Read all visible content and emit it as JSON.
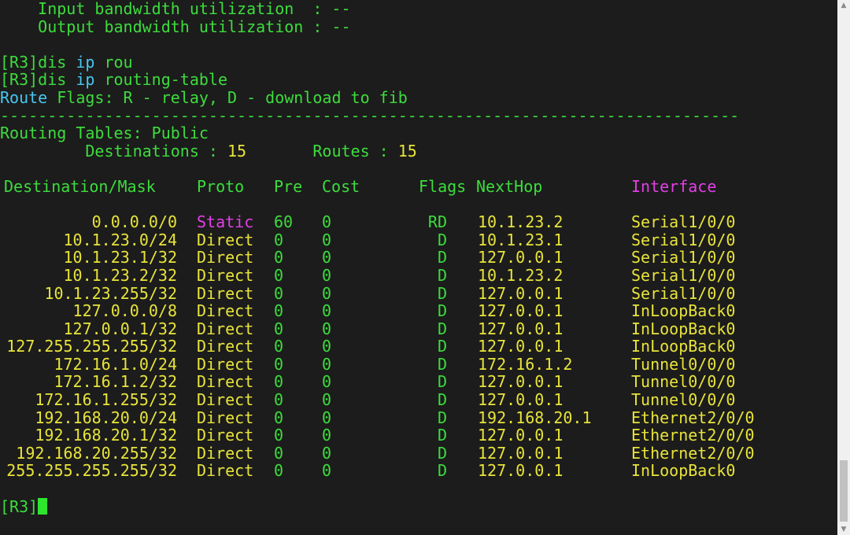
{
  "stats": {
    "input_bw": "    Input bandwidth utilization  : --",
    "output_bw": "    Output bandwidth utilization : --"
  },
  "commands": {
    "cmd1_prompt": "[R3]",
    "cmd1_verb": "dis ",
    "cmd1_kw": "ip",
    "cmd1_rest": " rou",
    "cmd2_prompt": "[R3]",
    "cmd2_verb": "dis ",
    "cmd2_kw": "ip",
    "cmd2_rest": " routing-table"
  },
  "flags_line": {
    "label": "Route",
    "text": " Flags: R - relay, D - download to fib"
  },
  "separator": "------------------------------------------------------------------------------",
  "routing_tables": {
    "title": "Routing Tables: Public",
    "destinations_label": "         Destinations : ",
    "destinations_value": "15",
    "routes_label": "       Routes : ",
    "routes_value": "15"
  },
  "table": {
    "headers": {
      "destination": "Destination/Mask",
      "proto": "Proto",
      "pre": "Pre",
      "cost": "Cost",
      "flags": "Flags",
      "nexthop": "NextHop",
      "interface": "Interface"
    },
    "rows": [
      {
        "dest": "0.0.0.0/0",
        "proto": "Static",
        "pre": "60",
        "cost": "0",
        "flags": "RD",
        "nexthop": "10.1.23.2",
        "iface": "Serial1/0/0"
      },
      {
        "dest": "10.1.23.0/24",
        "proto": "Direct",
        "pre": "0",
        "cost": "0",
        "flags": "D",
        "nexthop": "10.1.23.1",
        "iface": "Serial1/0/0"
      },
      {
        "dest": "10.1.23.1/32",
        "proto": "Direct",
        "pre": "0",
        "cost": "0",
        "flags": "D",
        "nexthop": "127.0.0.1",
        "iface": "Serial1/0/0"
      },
      {
        "dest": "10.1.23.2/32",
        "proto": "Direct",
        "pre": "0",
        "cost": "0",
        "flags": "D",
        "nexthop": "10.1.23.2",
        "iface": "Serial1/0/0"
      },
      {
        "dest": "10.1.23.255/32",
        "proto": "Direct",
        "pre": "0",
        "cost": "0",
        "flags": "D",
        "nexthop": "127.0.0.1",
        "iface": "Serial1/0/0"
      },
      {
        "dest": "127.0.0.0/8",
        "proto": "Direct",
        "pre": "0",
        "cost": "0",
        "flags": "D",
        "nexthop": "127.0.0.1",
        "iface": "InLoopBack0"
      },
      {
        "dest": "127.0.0.1/32",
        "proto": "Direct",
        "pre": "0",
        "cost": "0",
        "flags": "D",
        "nexthop": "127.0.0.1",
        "iface": "InLoopBack0"
      },
      {
        "dest": "127.255.255.255/32",
        "proto": "Direct",
        "pre": "0",
        "cost": "0",
        "flags": "D",
        "nexthop": "127.0.0.1",
        "iface": "InLoopBack0"
      },
      {
        "dest": "172.16.1.0/24",
        "proto": "Direct",
        "pre": "0",
        "cost": "0",
        "flags": "D",
        "nexthop": "172.16.1.2",
        "iface": "Tunnel0/0/0"
      },
      {
        "dest": "172.16.1.2/32",
        "proto": "Direct",
        "pre": "0",
        "cost": "0",
        "flags": "D",
        "nexthop": "127.0.0.1",
        "iface": "Tunnel0/0/0"
      },
      {
        "dest": "172.16.1.255/32",
        "proto": "Direct",
        "pre": "0",
        "cost": "0",
        "flags": "D",
        "nexthop": "127.0.0.1",
        "iface": "Tunnel0/0/0"
      },
      {
        "dest": "192.168.20.0/24",
        "proto": "Direct",
        "pre": "0",
        "cost": "0",
        "flags": "D",
        "nexthop": "192.168.20.1",
        "iface": "Ethernet2/0/0"
      },
      {
        "dest": "192.168.20.1/32",
        "proto": "Direct",
        "pre": "0",
        "cost": "0",
        "flags": "D",
        "nexthop": "127.0.0.1",
        "iface": "Ethernet2/0/0"
      },
      {
        "dest": "192.168.20.255/32",
        "proto": "Direct",
        "pre": "0",
        "cost": "0",
        "flags": "D",
        "nexthop": "127.0.0.1",
        "iface": "Ethernet2/0/0"
      },
      {
        "dest": "255.255.255.255/32",
        "proto": "Direct",
        "pre": "0",
        "cost": "0",
        "flags": "D",
        "nexthop": "127.0.0.1",
        "iface": "InLoopBack0"
      }
    ]
  },
  "prompt": {
    "text": "[R3]"
  },
  "scrollbar": {
    "up_icon": "▲",
    "down_icon": "▼"
  },
  "colors": {
    "background": "#1c1c1c",
    "green": "#3ddc3d",
    "yellow": "#e8e43a",
    "cyan": "#47c6f0",
    "magenta": "#e23fe6"
  }
}
